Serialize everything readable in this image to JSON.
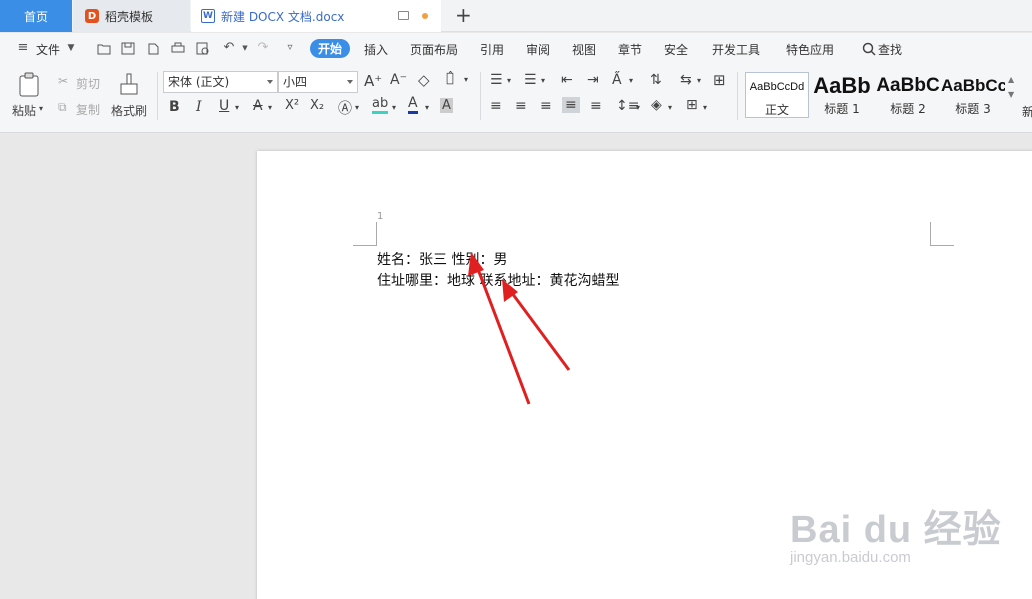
{
  "tabs": {
    "home": "首页",
    "template": "稻壳模板",
    "doc": "新建 DOCX 文档.docx",
    "template_icon_glyph": "D",
    "doc_icon_glyph": "W"
  },
  "menu": {
    "file": "文件",
    "start": "开始",
    "insert": "插入",
    "layout": "页面布局",
    "reference": "引用",
    "review": "审阅",
    "view": "视图",
    "chapter": "章节",
    "security": "安全",
    "developer": "开发工具",
    "special": "特色应用",
    "search": "查找"
  },
  "ribbon": {
    "paste": "粘贴",
    "cut": "剪切",
    "copy": "复制",
    "format_painter": "格式刷",
    "font_name": "宋体 (正文)",
    "font_size": "小四",
    "bold": "B",
    "italic": "I",
    "underline": "U",
    "styles": [
      {
        "preview": "AaBbCcDd",
        "label": "正文"
      },
      {
        "preview": "AaBb",
        "label": "标题 1"
      },
      {
        "preview": "AaBbC",
        "label": "标题 2"
      },
      {
        "preview": "AaBbCc",
        "label": "标题 3"
      }
    ],
    "more": "新"
  },
  "document": {
    "line_number": "1",
    "line1": "姓名：张三 性别：男",
    "line2": "住址哪里：地球 联系地址：黄花沟蜡型"
  },
  "watermark": {
    "main": "Bai du 经验",
    "sub": "jingyan.baidu.com"
  },
  "colors": {
    "accent": "#3a8ee6",
    "arrow": "#e02020"
  }
}
